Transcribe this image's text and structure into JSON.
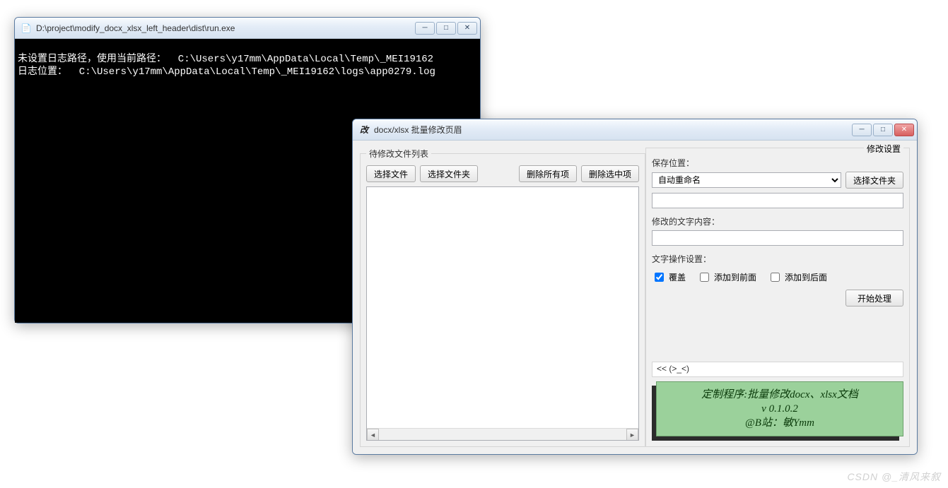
{
  "console": {
    "title": "D:\\project\\modify_docx_xlsx_left_header\\dist\\run.exe",
    "icon": "📄",
    "lines": [
      "未设置日志路径，使用当前路径：  C:\\Users\\y17mm\\AppData\\Local\\Temp\\_MEI19162",
      "日志位置：  C:\\Users\\y17mm\\AppData\\Local\\Temp\\_MEI19162\\logs\\app0279.log"
    ]
  },
  "app": {
    "icon_text": "改",
    "title": "docx/xlsx 批量修改页眉",
    "left": {
      "group_title": "待修改文件列表",
      "select_file": "选择文件",
      "select_folder": "选择文件夹",
      "delete_all": "删除所有项",
      "delete_selected": "删除选中项"
    },
    "right": {
      "group_title": "修改设置",
      "save_location_label": "保存位置：",
      "save_mode_selected": "自动重命名",
      "select_folder": "选择文件夹",
      "save_path": "",
      "content_label": "修改的文字内容：",
      "content_value": "",
      "op_label": "文字操作设置：",
      "cb_overwrite": "覆盖",
      "cb_prepend": "添加到前面",
      "cb_append": "添加到后面",
      "cb_overwrite_checked": true,
      "cb_prepend_checked": false,
      "cb_append_checked": false,
      "start_btn": "开始处理",
      "status_text": "<< (>_<)",
      "promo_line1": "定制程序:批量修改docx、xlsx文档",
      "promo_line2": "v 0.1.0.2",
      "promo_line3": "@B站：敏Ymm"
    }
  },
  "watermark": "CSDN @_清风来叙"
}
